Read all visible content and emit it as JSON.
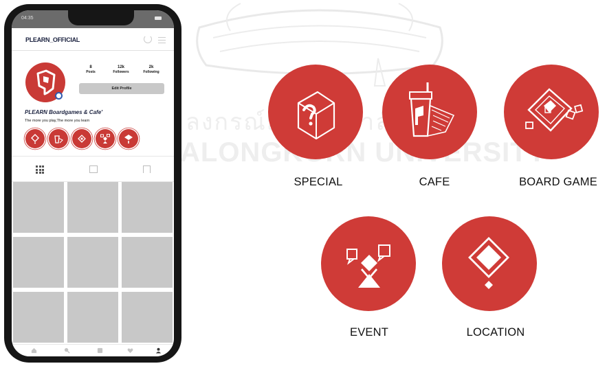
{
  "phone": {
    "status_time": "04:35",
    "username": "PLEARN_OFFICIAL",
    "stats": [
      {
        "value": "8",
        "label": "Posts"
      },
      {
        "value": "12k",
        "label": "Followers"
      },
      {
        "value": "2k",
        "label": "Following"
      }
    ],
    "edit_profile_label": "Edit Profile",
    "bio_name": "PLEARN Boardgames & Cafe'",
    "bio_text": "The more you play,The more you learn",
    "highlights": [
      "location-icon",
      "cafe-icon",
      "board-game-icon",
      "event-icon",
      "special-icon"
    ],
    "tabs": [
      "grid-icon",
      "reels-icon",
      "tagged-icon"
    ],
    "post_count_shown": 9,
    "bottom_nav": [
      "home-icon",
      "search-icon",
      "add-post-icon",
      "heart-icon",
      "profile-icon"
    ]
  },
  "categories": [
    {
      "label": "SPECIAL",
      "icon": "special-icon"
    },
    {
      "label": "CAFE",
      "icon": "cafe-icon"
    },
    {
      "label": "BOARD GAME",
      "icon": "board-game-icon"
    },
    {
      "label": "EVENT",
      "icon": "event-icon"
    },
    {
      "label": "LOCATION",
      "icon": "location-icon"
    }
  ],
  "colors": {
    "brand_red": "#cf3b37",
    "phone_frame": "#161616",
    "placeholder_gray": "#c8c8c8",
    "username_navy": "#1c2340"
  },
  "watermark": {
    "thai": "ลงกรณ์มหาวิทยาลัย",
    "english": "ALONGKORN UNIVERSITY"
  }
}
